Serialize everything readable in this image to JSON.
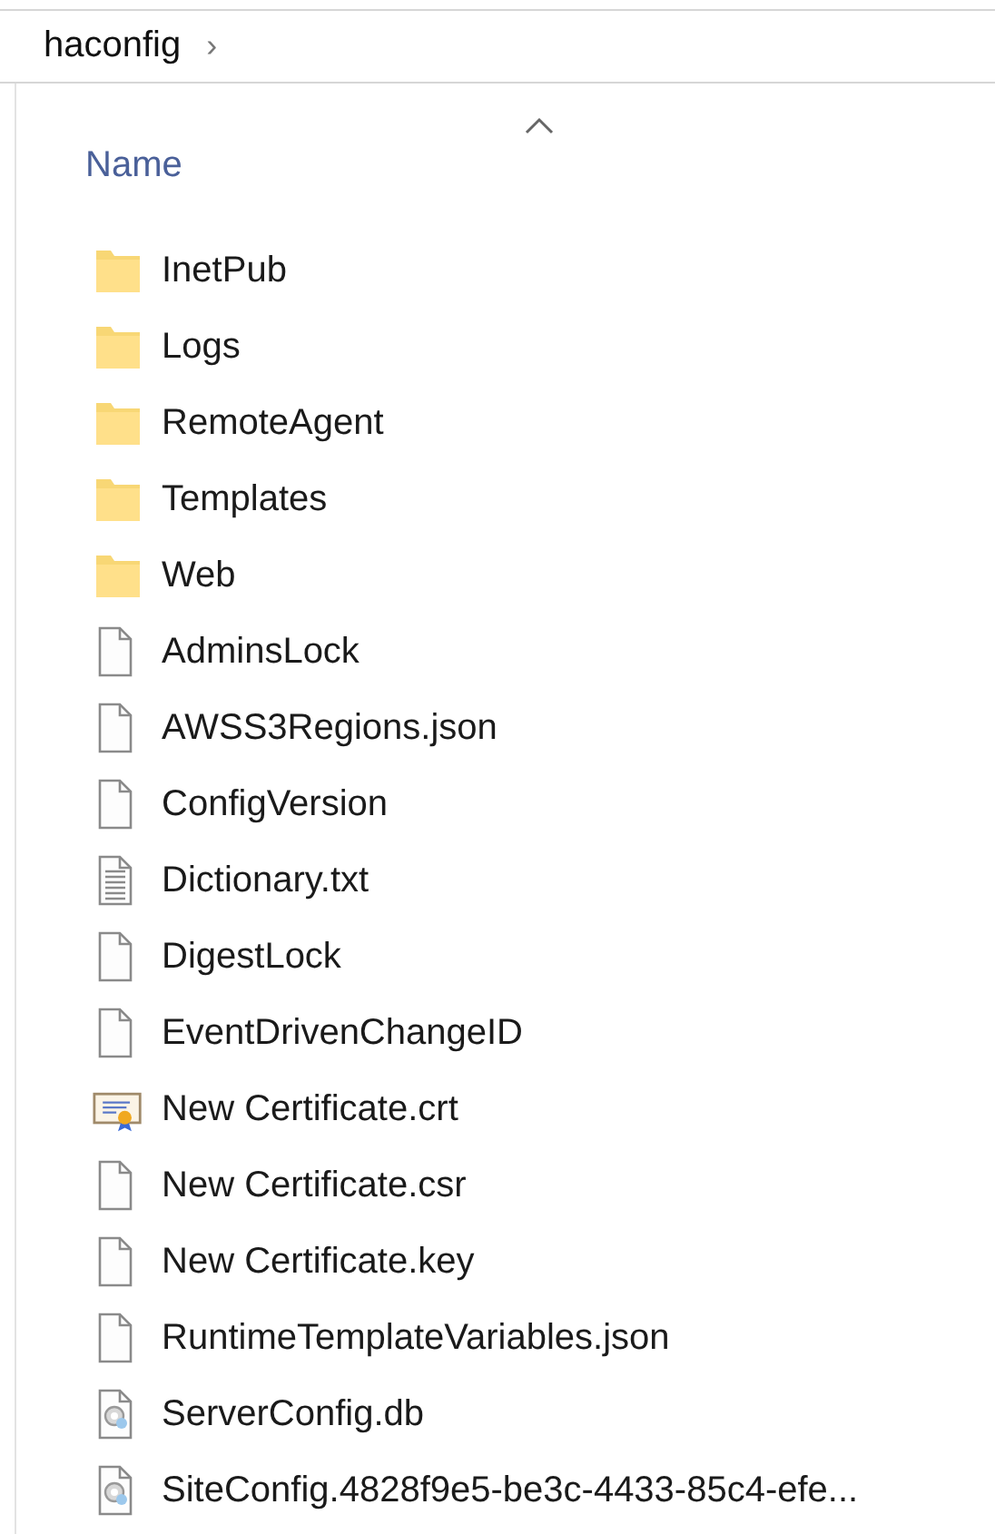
{
  "breadcrumb": {
    "folder": "haconfig",
    "separator": "›"
  },
  "columns": [
    {
      "label": "Name",
      "sorted_ascending": true
    }
  ],
  "files": [
    {
      "name": "InetPub",
      "kind": "folder"
    },
    {
      "name": "Logs",
      "kind": "folder"
    },
    {
      "name": "RemoteAgent",
      "kind": "folder"
    },
    {
      "name": "Templates",
      "kind": "folder"
    },
    {
      "name": "Web",
      "kind": "folder"
    },
    {
      "name": "AdminsLock",
      "kind": "file"
    },
    {
      "name": "AWSS3Regions.json",
      "kind": "file"
    },
    {
      "name": "ConfigVersion",
      "kind": "file"
    },
    {
      "name": "Dictionary.txt",
      "kind": "text"
    },
    {
      "name": "DigestLock",
      "kind": "file"
    },
    {
      "name": "EventDrivenChangeID",
      "kind": "file"
    },
    {
      "name": "New Certificate.crt",
      "kind": "certificate"
    },
    {
      "name": "New Certificate.csr",
      "kind": "file"
    },
    {
      "name": "New Certificate.key",
      "kind": "file"
    },
    {
      "name": "RuntimeTemplateVariables.json",
      "kind": "file"
    },
    {
      "name": "ServerConfig.db",
      "kind": "settings"
    },
    {
      "name": "SiteConfig.4828f9e5-be3c-4433-85c4-efe...",
      "kind": "settings"
    }
  ]
}
